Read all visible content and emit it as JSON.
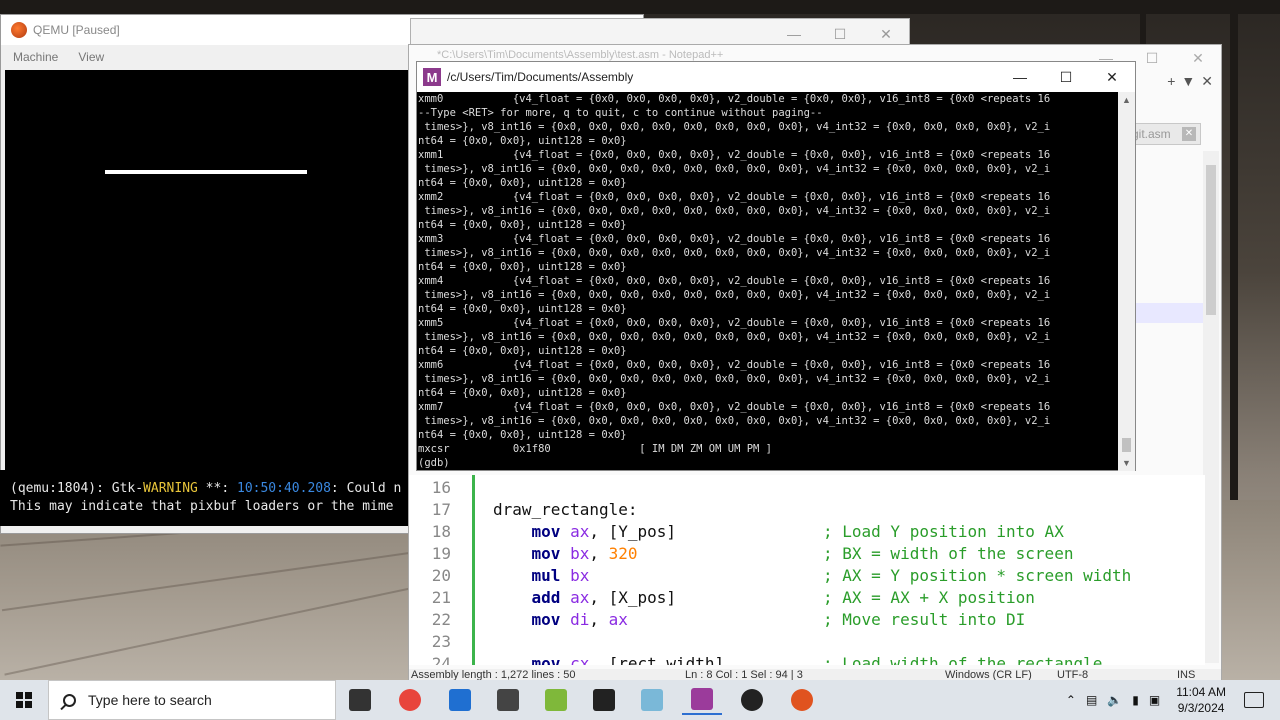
{
  "qemu": {
    "title": "QEMU [Paused]",
    "menu": [
      "Machine",
      "View"
    ],
    "terminal_lines": [
      {
        "prefix": "(qemu:1804): Gtk-",
        "warn": "WARNING",
        "mid": " **: ",
        "time": "10:50:40.208",
        "suffix": ": Could n"
      },
      {
        "prefix": "This may indicate that pixbuf loaders or the mime",
        "warn": "",
        "mid": "",
        "time": "",
        "suffix": ""
      }
    ]
  },
  "npp_ghost": {
    "title": "*C:\\Users\\Tim\\Documents\\Assembly\\test.asm - Notepad++"
  },
  "npp": {
    "tab_label": "git.asm",
    "code_lines": [
      {
        "n": "16",
        "code": [],
        "comment": ""
      },
      {
        "n": "17",
        "code": [
          {
            "t": "draw_rectangle:",
            "c": "plain"
          }
        ],
        "comment": ""
      },
      {
        "n": "18",
        "code": [
          {
            "t": "    mov ",
            "c": "kw"
          },
          {
            "t": "ax",
            "c": "reg"
          },
          {
            "t": ", [Y_pos]",
            "c": "plain"
          }
        ],
        "comment": "; Load Y position into AX"
      },
      {
        "n": "19",
        "code": [
          {
            "t": "    mov ",
            "c": "kw"
          },
          {
            "t": "bx",
            "c": "reg"
          },
          {
            "t": ", ",
            "c": "plain"
          },
          {
            "t": "320",
            "c": "num"
          }
        ],
        "comment": "; BX = width of the screen"
      },
      {
        "n": "20",
        "code": [
          {
            "t": "    mul ",
            "c": "kw"
          },
          {
            "t": "bx",
            "c": "reg"
          }
        ],
        "comment": "; AX = Y position * screen width"
      },
      {
        "n": "21",
        "code": [
          {
            "t": "    add ",
            "c": "kw"
          },
          {
            "t": "ax",
            "c": "reg"
          },
          {
            "t": ", [X_pos]",
            "c": "plain"
          }
        ],
        "comment": "; AX = AX + X position"
      },
      {
        "n": "22",
        "code": [
          {
            "t": "    mov ",
            "c": "kw"
          },
          {
            "t": "di",
            "c": "reg"
          },
          {
            "t": ", ",
            "c": "plain"
          },
          {
            "t": "ax",
            "c": "reg"
          }
        ],
        "comment": "; Move result into DI"
      },
      {
        "n": "23",
        "code": [],
        "comment": ""
      },
      {
        "n": "24",
        "code": [
          {
            "t": "    mov ",
            "c": "kw"
          },
          {
            "t": "cx",
            "c": "reg"
          },
          {
            "t": ", [rect_width]",
            "c": "plain"
          }
        ],
        "comment": "; Load width of the rectangle"
      }
    ],
    "status": {
      "length": "Assembly  length : 1,272    lines : 50",
      "position": "Ln : 8    Col : 1    Sel : 94 | 3",
      "eol": "Windows (CR LF)",
      "encoding": "UTF-8",
      "mode": "INS"
    }
  },
  "gdb": {
    "title": "/c/Users/Tim/Documents/Assembly",
    "lines": [
      "xmm0           {v4_float = {0x0, 0x0, 0x0, 0x0}, v2_double = {0x0, 0x0}, v16_int8 = {0x0 <repeats 16",
      "--Type <RET> for more, q to quit, c to continue without paging--",
      " times>}, v8_int16 = {0x0, 0x0, 0x0, 0x0, 0x0, 0x0, 0x0, 0x0}, v4_int32 = {0x0, 0x0, 0x0, 0x0}, v2_i",
      "nt64 = {0x0, 0x0}, uint128 = 0x0}",
      "xmm1           {v4_float = {0x0, 0x0, 0x0, 0x0}, v2_double = {0x0, 0x0}, v16_int8 = {0x0 <repeats 16",
      " times>}, v8_int16 = {0x0, 0x0, 0x0, 0x0, 0x0, 0x0, 0x0, 0x0}, v4_int32 = {0x0, 0x0, 0x0, 0x0}, v2_i",
      "nt64 = {0x0, 0x0}, uint128 = 0x0}",
      "xmm2           {v4_float = {0x0, 0x0, 0x0, 0x0}, v2_double = {0x0, 0x0}, v16_int8 = {0x0 <repeats 16",
      " times>}, v8_int16 = {0x0, 0x0, 0x0, 0x0, 0x0, 0x0, 0x0, 0x0}, v4_int32 = {0x0, 0x0, 0x0, 0x0}, v2_i",
      "nt64 = {0x0, 0x0}, uint128 = 0x0}",
      "xmm3           {v4_float = {0x0, 0x0, 0x0, 0x0}, v2_double = {0x0, 0x0}, v16_int8 = {0x0 <repeats 16",
      " times>}, v8_int16 = {0x0, 0x0, 0x0, 0x0, 0x0, 0x0, 0x0, 0x0}, v4_int32 = {0x0, 0x0, 0x0, 0x0}, v2_i",
      "nt64 = {0x0, 0x0}, uint128 = 0x0}",
      "xmm4           {v4_float = {0x0, 0x0, 0x0, 0x0}, v2_double = {0x0, 0x0}, v16_int8 = {0x0 <repeats 16",
      " times>}, v8_int16 = {0x0, 0x0, 0x0, 0x0, 0x0, 0x0, 0x0, 0x0}, v4_int32 = {0x0, 0x0, 0x0, 0x0}, v2_i",
      "nt64 = {0x0, 0x0}, uint128 = 0x0}",
      "xmm5           {v4_float = {0x0, 0x0, 0x0, 0x0}, v2_double = {0x0, 0x0}, v16_int8 = {0x0 <repeats 16",
      " times>}, v8_int16 = {0x0, 0x0, 0x0, 0x0, 0x0, 0x0, 0x0, 0x0}, v4_int32 = {0x0, 0x0, 0x0, 0x0}, v2_i",
      "nt64 = {0x0, 0x0}, uint128 = 0x0}",
      "xmm6           {v4_float = {0x0, 0x0, 0x0, 0x0}, v2_double = {0x0, 0x0}, v16_int8 = {0x0 <repeats 16",
      " times>}, v8_int16 = {0x0, 0x0, 0x0, 0x0, 0x0, 0x0, 0x0, 0x0}, v4_int32 = {0x0, 0x0, 0x0, 0x0}, v2_i",
      "nt64 = {0x0, 0x0}, uint128 = 0x0}",
      "xmm7           {v4_float = {0x0, 0x0, 0x0, 0x0}, v2_double = {0x0, 0x0}, v16_int8 = {0x0 <repeats 16",
      " times>}, v8_int16 = {0x0, 0x0, 0x0, 0x0, 0x0, 0x0, 0x0, 0x0}, v4_int32 = {0x0, 0x0, 0x0, 0x0}, v2_i",
      "nt64 = {0x0, 0x0}, uint128 = 0x0}",
      "mxcsr          0x1f80              [ IM DM ZM OM UM PM ]",
      "(gdb)"
    ]
  },
  "taskbar": {
    "search_placeholder": "Type here to search",
    "time": "11:04 AM",
    "date": "9/3/2024",
    "apps": [
      {
        "name": "task-view",
        "color": "#333333"
      },
      {
        "name": "chrome",
        "color": "#e8453c"
      },
      {
        "name": "mail",
        "color": "#1f6fd1"
      },
      {
        "name": "viewer",
        "color": "#444444"
      },
      {
        "name": "notepad-plus-plus",
        "color": "#7fb83a"
      },
      {
        "name": "terminal",
        "color": "#222222"
      },
      {
        "name": "notepad",
        "color": "#7ab8d8"
      },
      {
        "name": "mintty",
        "color": "#9b3b9b"
      },
      {
        "name": "obs",
        "color": "#222222"
      },
      {
        "name": "qemu",
        "color": "#e0531f"
      }
    ]
  }
}
